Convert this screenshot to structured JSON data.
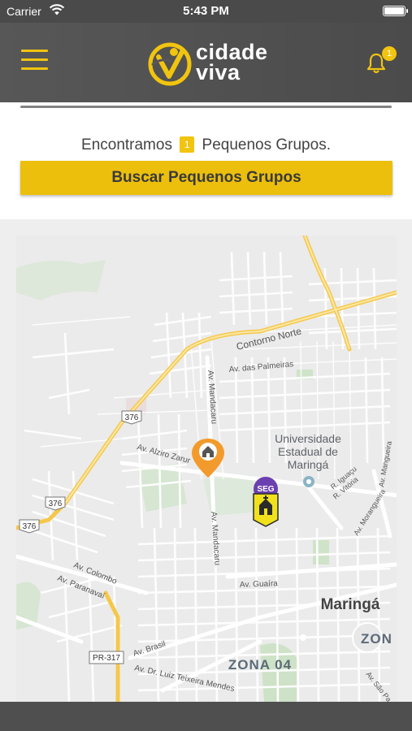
{
  "status_bar": {
    "carrier": "Carrier",
    "time": "5:43 PM"
  },
  "header": {
    "logo_line1": "cidade",
    "logo_line2": "viva",
    "notification_count": "1",
    "accent_color": "#f1c40f"
  },
  "search": {
    "found_prefix": "Encontramos",
    "found_count": "1",
    "found_suffix": "Pequenos Grupos.",
    "button_label": "Buscar Pequenos Grupos"
  },
  "map": {
    "road_labels": {
      "contorno_norte": "Contorno Norte",
      "palmeiras": "Av. das Palmeiras",
      "mandacaru_top": "Av. Mandacaru",
      "mandacaru_mid": "Av. Mandacaru",
      "alziro": "Av. Alziro Zarur",
      "colombo": "Av. Colombo",
      "paranavai": "Av. Paranavaí",
      "guaira": "Av. Guaíra",
      "brasil": "Av. Brasil",
      "luiz_mendes": "Av. Dr. Luiz Teixeira Mendes",
      "iguacu": "R. Iguaçu",
      "vitoria": "R. Vitória",
      "morangueira": "Av. Morangueira",
      "mangueira": "Av. Mangueira",
      "sao_pa": "Av. São Pa"
    },
    "shields": {
      "s376_a": "376",
      "s376_b": "376",
      "s376_c": "376",
      "pr317": "PR-317"
    },
    "places": {
      "university_1": "Universidade",
      "university_2": "Estadual de",
      "university_3": "Maringá",
      "city": "Maringá",
      "zona04": "ZONA 04",
      "zon": "ZON"
    },
    "church_marker_label": "SEG"
  }
}
